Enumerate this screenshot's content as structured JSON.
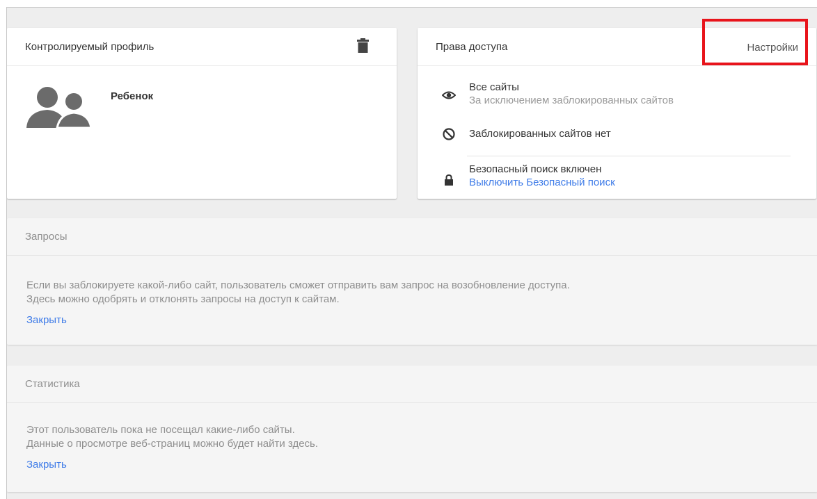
{
  "profile": {
    "title": "Контролируемый профиль",
    "child_name": "Ребенок",
    "icons": {
      "delete": "trash-icon",
      "avatar": "people-icon"
    }
  },
  "access": {
    "title": "Права доступа",
    "settings_label": "Настройки",
    "all_sites_title": "Все сайты",
    "all_sites_sub": "За исключением заблокированных сайтов",
    "no_blocked": "Заблокированных сайтов нет",
    "safe_search_title": "Безопасный поиск включен",
    "safe_search_link": "Выключить Безопасный поиск",
    "icons": {
      "all_sites": "eye-icon",
      "blocked": "block-icon",
      "safe_search": "lock-icon"
    }
  },
  "requests": {
    "title": "Запросы",
    "line1": "Если вы заблокируете какой-либо сайт, пользователь сможет отправить вам запрос на возобновление доступа.",
    "line2": "Здесь можно одобрять и отклонять запросы на доступ к сайтам.",
    "close_label": "Закрыть"
  },
  "stats": {
    "title": "Статистика",
    "line1": "Этот пользователь пока не посещал какие-либо сайты.",
    "line2": "Данные о просмотре веб-страниц можно будет найти здесь.",
    "close_label": "Закрыть"
  },
  "colors": {
    "link": "#3f7ce8",
    "highlight": "#e8141b",
    "background": "#eeeeee"
  }
}
